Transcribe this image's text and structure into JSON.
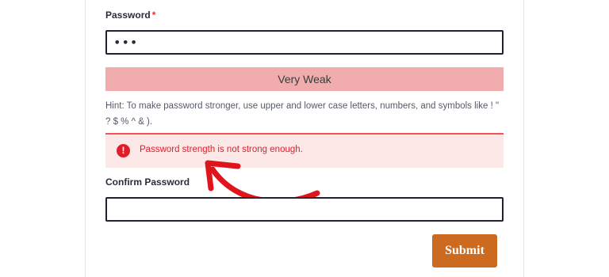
{
  "form": {
    "password": {
      "label": "Password",
      "required_marker": "*",
      "value": "•••"
    },
    "strength": {
      "label": "Very Weak",
      "color": "#f1adad"
    },
    "hint": "Hint: To make password stronger, use upper and lower case letters, numbers, and symbols like ! \" ? $ % ^ & ).",
    "error": {
      "icon": "!",
      "message": "Password strength is not strong enough.",
      "color": "#e01e2a"
    },
    "confirm_password": {
      "label": "Confirm Password",
      "value": ""
    },
    "submit_label": "Submit",
    "accent_color": "#cc6b1f"
  }
}
